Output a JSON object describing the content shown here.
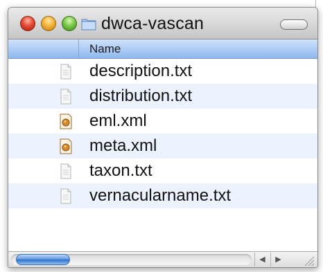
{
  "window": {
    "title": "dwca-vascan",
    "title_icon": "folder-icon",
    "buttons": {
      "close": "close-button",
      "minimize": "minimize-button",
      "zoom": "zoom-button",
      "toolbar_toggle": "toolbar-toggle-button"
    }
  },
  "list": {
    "column_header": "Name",
    "files": [
      {
        "name": "description.txt",
        "icon": "text-file-icon"
      },
      {
        "name": "distribution.txt",
        "icon": "text-file-icon"
      },
      {
        "name": "eml.xml",
        "icon": "xml-file-icon"
      },
      {
        "name": "meta.xml",
        "icon": "xml-file-icon"
      },
      {
        "name": "taxon.txt",
        "icon": "text-file-icon"
      },
      {
        "name": "vernacularname.txt",
        "icon": "text-file-icon"
      }
    ]
  },
  "scrollbar": {
    "left_arrow": "◀",
    "right_arrow": "▶"
  },
  "colors": {
    "header_blue": "#8fb8ee",
    "alt_row": "#edf3fe",
    "close_red": "#e64a35",
    "minimize_yellow": "#f5b339",
    "zoom_green": "#7ac74a"
  }
}
